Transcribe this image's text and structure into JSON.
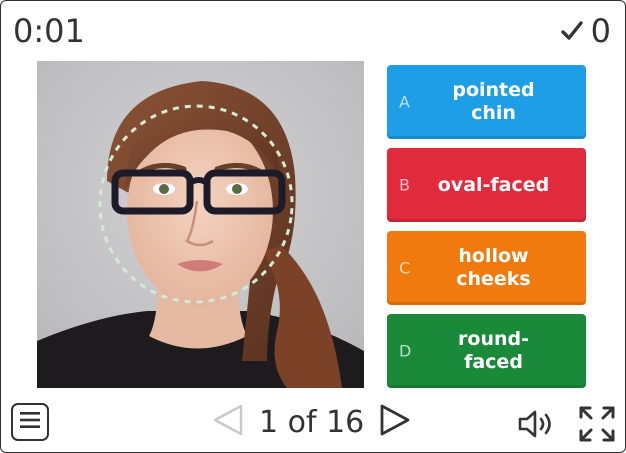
{
  "timer": {
    "value": "0:01"
  },
  "score": {
    "icon": "checkmark-icon",
    "value": "0"
  },
  "question": {
    "image": "face-photo-with-glasses"
  },
  "answers": [
    {
      "letter": "A",
      "text": "pointed chin",
      "color": "#1e9ee6"
    },
    {
      "letter": "B",
      "text": "oval-faced",
      "color": "#e12a3c"
    },
    {
      "letter": "C",
      "text": "hollow cheeks",
      "color": "#f07a0d"
    },
    {
      "letter": "D",
      "text": "round-faced",
      "color": "#1a8a3a"
    }
  ],
  "toolbar": {
    "menu_icon": "menu-icon",
    "prev_icon": "prev-triangle-icon",
    "page_label": "1 of 16",
    "next_icon": "next-triangle-icon",
    "sound_icon": "speaker-icon",
    "fullscreen_icon": "fullscreen-icon"
  }
}
